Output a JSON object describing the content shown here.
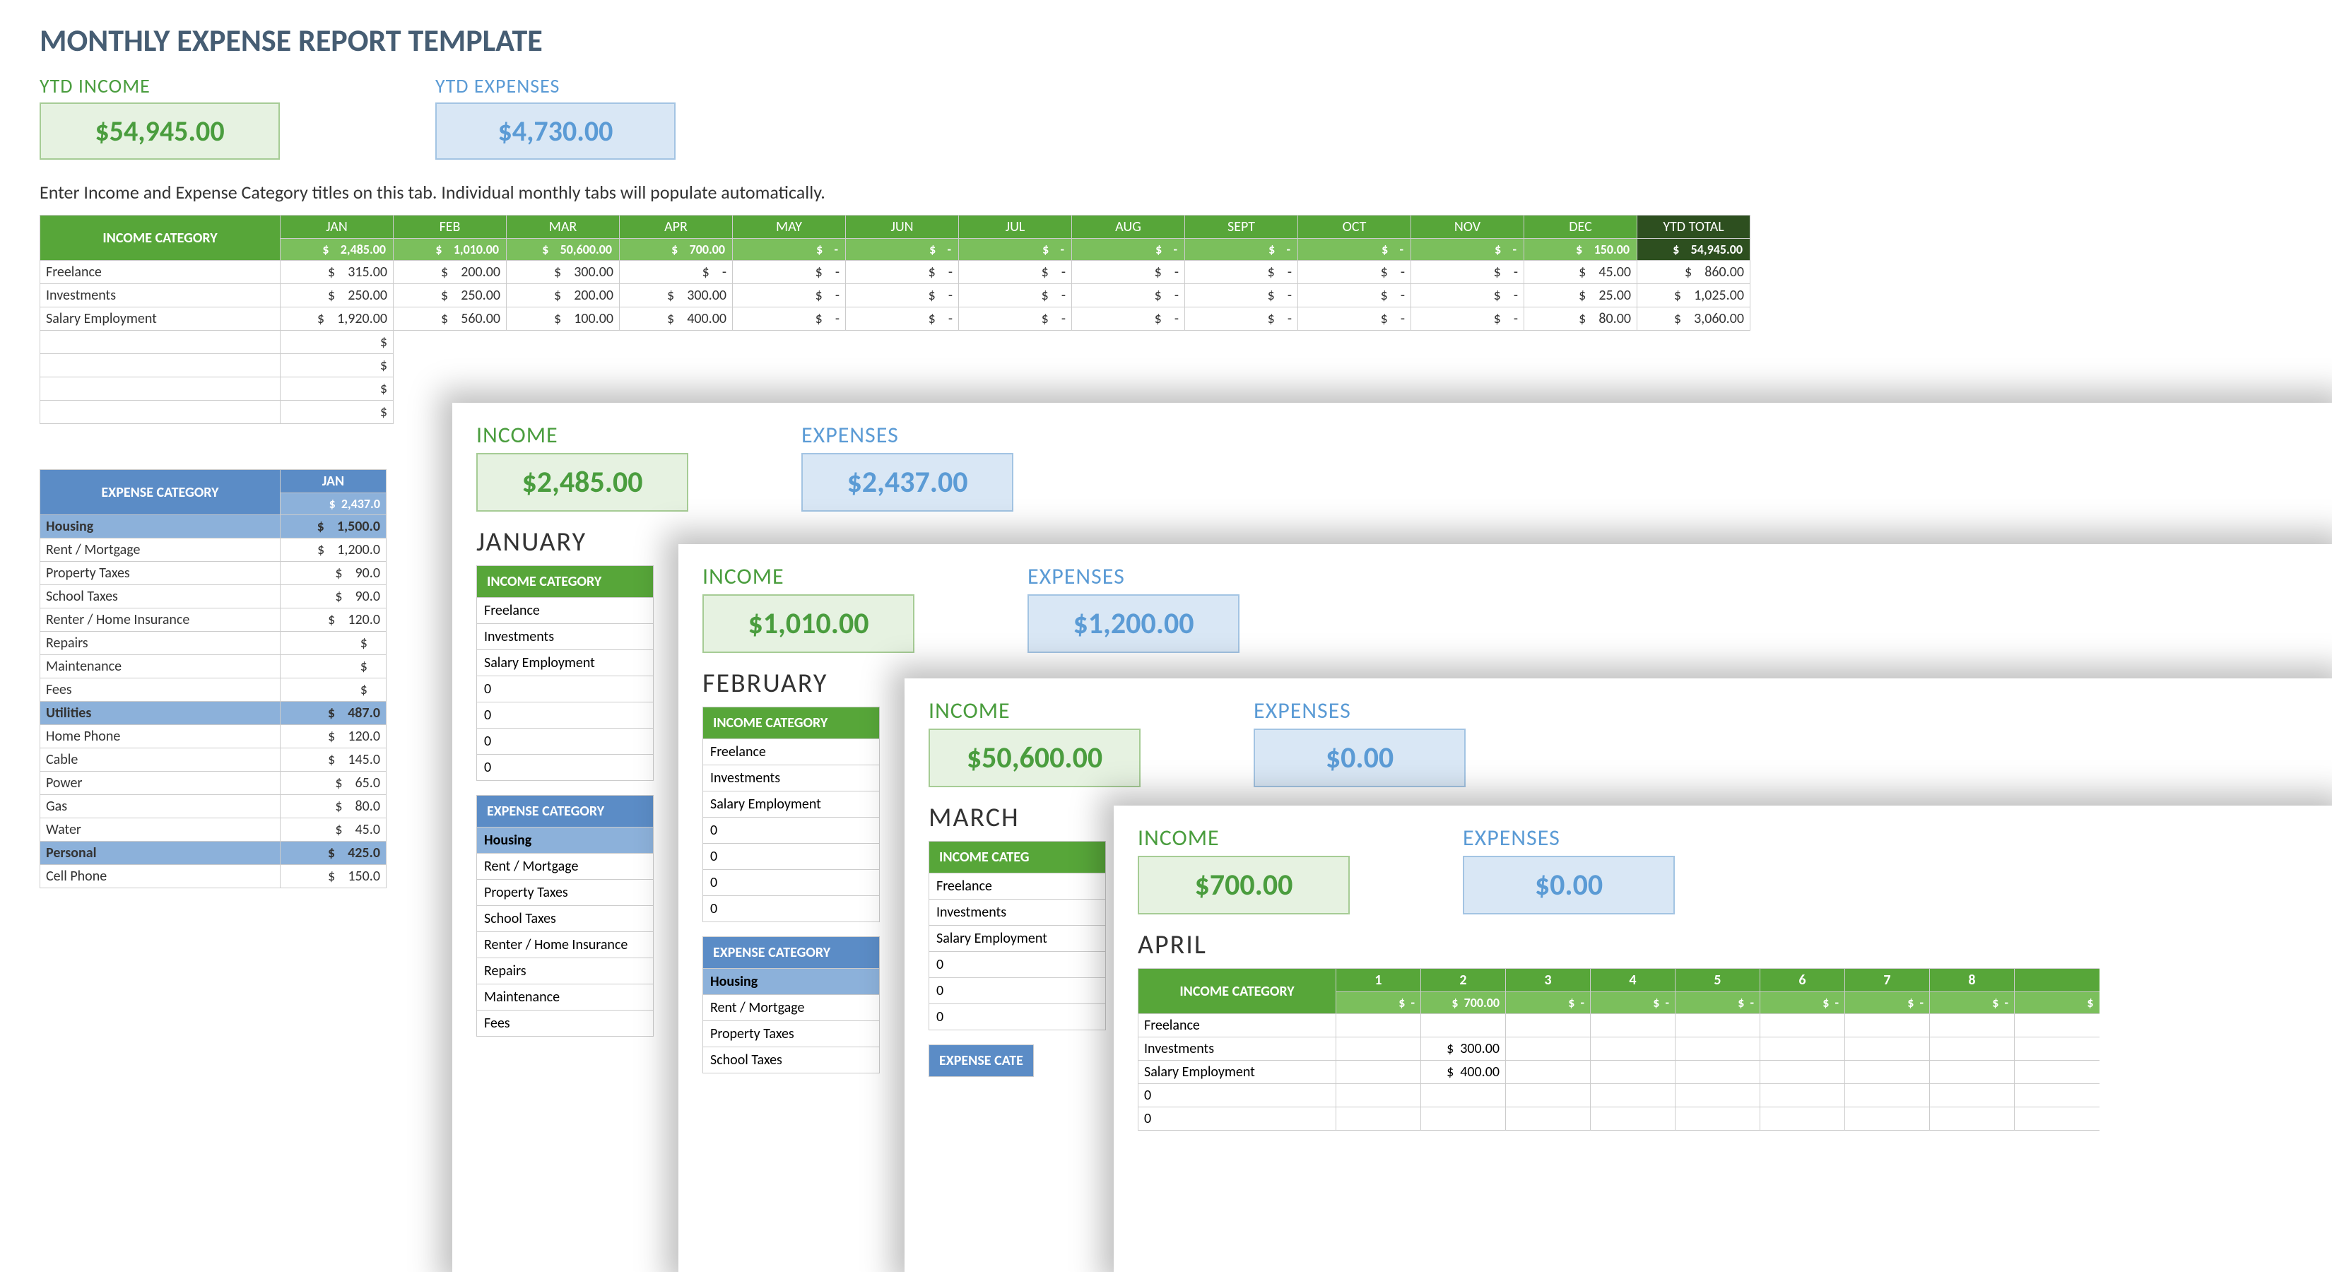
{
  "title": "MONTHLY EXPENSE REPORT TEMPLATE",
  "ytd": {
    "income_label": "YTD INCOME",
    "income_value": "$54,945.00",
    "expense_label": "YTD EXPENSES",
    "expense_value": "$4,730.00"
  },
  "instruction": "Enter Income and Expense Category titles on this tab.  Individual monthly tabs will populate automatically.",
  "months": [
    "JAN",
    "FEB",
    "MAR",
    "APR",
    "MAY",
    "JUN",
    "JUL",
    "AUG",
    "SEPT",
    "OCT",
    "NOV",
    "DEC"
  ],
  "ytd_total_label": "YTD TOTAL",
  "income_category_label": "INCOME CATEGORY",
  "expense_category_label": "EXPENSE CATEGORY",
  "income_totals": [
    "2,485.00",
    "1,010.00",
    "50,600.00",
    "700.00",
    "-",
    "-",
    "-",
    "-",
    "-",
    "-",
    "-",
    "150.00",
    "54,945.00"
  ],
  "income_rows": [
    {
      "name": "Freelance",
      "vals": [
        "315.00",
        "200.00",
        "300.00",
        "-",
        "-",
        "-",
        "-",
        "-",
        "-",
        "-",
        "-",
        "45.00",
        "860.00"
      ]
    },
    {
      "name": "Investments",
      "vals": [
        "250.00",
        "250.00",
        "200.00",
        "300.00",
        "-",
        "-",
        "-",
        "-",
        "-",
        "-",
        "-",
        "25.00",
        "1,025.00"
      ]
    },
    {
      "name": "Salary Employment",
      "vals": [
        "1,920.00",
        "560.00",
        "100.00",
        "400.00",
        "-",
        "-",
        "-",
        "-",
        "-",
        "-",
        "-",
        "80.00",
        "3,060.00"
      ]
    }
  ],
  "expense_jan_total": "2,437.0",
  "expense_groups": [
    {
      "name": "Housing",
      "total": "1,500.0",
      "rows": [
        {
          "name": "Rent / Mortgage",
          "val": "1,200.0"
        },
        {
          "name": "Property Taxes",
          "val": "90.0"
        },
        {
          "name": "School Taxes",
          "val": "90.0"
        },
        {
          "name": "Renter / Home Insurance",
          "val": "120.0"
        },
        {
          "name": "Repairs",
          "val": ""
        },
        {
          "name": "Maintenance",
          "val": ""
        },
        {
          "name": "Fees",
          "val": ""
        }
      ]
    },
    {
      "name": "Utilities",
      "total": "487.0",
      "rows": [
        {
          "name": "Home Phone",
          "val": "120.0"
        },
        {
          "name": "Cable",
          "val": "145.0"
        },
        {
          "name": "Power",
          "val": "65.0"
        },
        {
          "name": "Gas",
          "val": "80.0"
        },
        {
          "name": "Water",
          "val": "45.0"
        }
      ]
    },
    {
      "name": "Personal",
      "total": "425.0",
      "rows": [
        {
          "name": "Cell Phone",
          "val": "150.0"
        }
      ]
    }
  ],
  "sheet1": {
    "income_label": "INCOME",
    "income_value": "$2,485.00",
    "expense_label": "EXPENSES",
    "expense_value": "$2,437.00",
    "month": "JANUARY",
    "rows": [
      "Freelance",
      "Investments",
      "Salary Employment",
      "0",
      "0",
      "0",
      "0"
    ],
    "exp_group": "Housing",
    "exp_rows": [
      "Rent / Mortgage",
      "Property Taxes",
      "School Taxes",
      "Renter / Home Insurance",
      "Repairs",
      "Maintenance",
      "Fees"
    ]
  },
  "sheet2": {
    "income_label": "INCOME",
    "income_value": "$1,010.00",
    "expense_label": "EXPENSES",
    "expense_value": "$1,200.00",
    "month": "FEBRUARY",
    "rows": [
      "Freelance",
      "Investments",
      "Salary Employment",
      "0",
      "0",
      "0",
      "0"
    ],
    "exp_group": "Housing",
    "exp_rows": [
      "Rent / Mortgage",
      "Property Taxes",
      "School Taxes"
    ]
  },
  "sheet3": {
    "income_label": "INCOME",
    "income_value": "$50,600.00",
    "expense_label": "EXPENSES",
    "expense_value": "$0.00",
    "month": "MARCH",
    "rows": [
      "Freelance",
      "Investments",
      "Salary Employment",
      "0",
      "0",
      "0"
    ]
  },
  "sheet4": {
    "income_label": "INCOME",
    "income_value": "$700.00",
    "expense_label": "EXPENSES",
    "expense_value": "$0.00",
    "month": "APRIL",
    "day_headers": [
      "1",
      "2",
      "3",
      "4",
      "5",
      "6",
      "7",
      "8"
    ],
    "day_totals": [
      "-",
      "700.00",
      "-",
      "-",
      "-",
      "-",
      "-",
      "-"
    ],
    "rows": [
      {
        "name": "Freelance",
        "vals": [
          "",
          "",
          "",
          "",
          "",
          "",
          "",
          ""
        ]
      },
      {
        "name": "Investments",
        "vals": [
          "",
          "300.00",
          "",
          "",
          "",
          "",
          "",
          ""
        ]
      },
      {
        "name": "Salary Employment",
        "vals": [
          "",
          "400.00",
          "",
          "",
          "",
          "",
          "",
          ""
        ]
      },
      {
        "name": "0",
        "vals": [
          "",
          "",
          "",
          "",
          "",
          "",
          "",
          ""
        ]
      },
      {
        "name": "0",
        "vals": [
          "",
          "",
          "",
          "",
          "",
          "",
          "",
          ""
        ]
      }
    ]
  },
  "dollar": "$"
}
